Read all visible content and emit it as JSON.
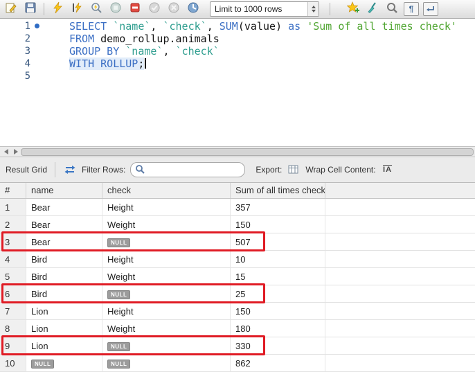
{
  "toolbar": {
    "limit_dropdown": "Limit to 1000 rows",
    "icons": [
      "open-script",
      "save",
      "execute",
      "execute-current-statement",
      "explain",
      "stop",
      "toggle-stop-on-error",
      "commit",
      "rollback",
      "toggle-autocommit",
      "new-snippet",
      "beautify",
      "find",
      "show-invisibles",
      "toggle-wrap"
    ]
  },
  "editor": {
    "lines": [
      {
        "number": "1",
        "segments": [
          {
            "text": "SELECT "
          },
          {
            "text": "`name`"
          },
          {
            "text": ", "
          },
          {
            "text": "`check`"
          },
          {
            "text": ", "
          },
          {
            "text": "SUM"
          },
          {
            "text": "(value) "
          },
          {
            "text": "as "
          },
          {
            "text": "'Sum of all times check'"
          }
        ]
      },
      {
        "number": "2",
        "segments": [
          {
            "text": "FROM "
          },
          {
            "text": "demo_rollup.animals"
          }
        ]
      },
      {
        "number": "3",
        "segments": [
          {
            "text": "GROUP BY "
          },
          {
            "text": "`name`"
          },
          {
            "text": ", "
          },
          {
            "text": "`check`"
          }
        ]
      },
      {
        "number": "4",
        "segments": [
          {
            "text": "WITH ROLLUP"
          },
          {
            "text": ";"
          }
        ]
      },
      {
        "number": "5",
        "segments": []
      }
    ]
  },
  "result_grid": {
    "title": "Result Grid",
    "filter_label": "Filter Rows:",
    "export_label": "Export:",
    "wrap_label": "Wrap Cell Content:",
    "columns": [
      "#",
      "name",
      "check",
      "Sum of all times check"
    ],
    "null_badge_text": "NULL",
    "highlight_color": "#e01b24",
    "rows": [
      {
        "num": "1",
        "name": "Bear",
        "check": "Height",
        "sum": "357"
      },
      {
        "num": "2",
        "name": "Bear",
        "check": "Weight",
        "sum": "150"
      },
      {
        "num": "3",
        "name": "Bear",
        "check": "NULL",
        "sum": "507",
        "highlighted": true
      },
      {
        "num": "4",
        "name": "Bird",
        "check": "Height",
        "sum": "10"
      },
      {
        "num": "5",
        "name": "Bird",
        "check": "Weight",
        "sum": "15"
      },
      {
        "num": "6",
        "name": "Bird",
        "check": "NULL",
        "sum": "25",
        "highlighted": true
      },
      {
        "num": "7",
        "name": "Lion",
        "check": "Height",
        "sum": "150"
      },
      {
        "num": "8",
        "name": "Lion",
        "check": "Weight",
        "sum": "180"
      },
      {
        "num": "9",
        "name": "Lion",
        "check": "NULL",
        "sum": "330",
        "highlighted": true
      },
      {
        "num": "10",
        "name": "NULL",
        "check": "NULL",
        "sum": "862"
      }
    ]
  }
}
